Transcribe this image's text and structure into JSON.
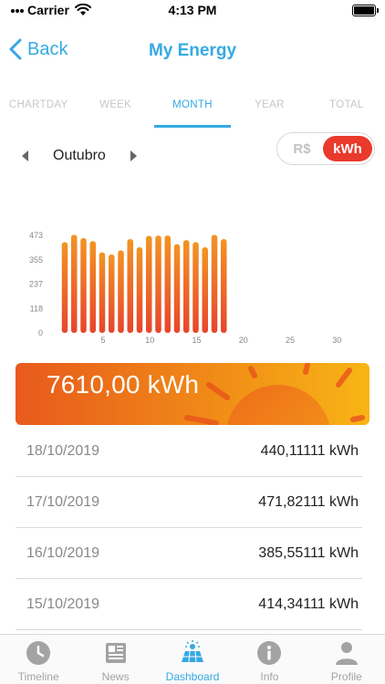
{
  "status_bar": {
    "carrier": "Carrier",
    "time": "4:13 PM"
  },
  "nav": {
    "back_label": "Back",
    "title": "My Energy"
  },
  "tabs": [
    {
      "label": "CHARTDAY",
      "active": false
    },
    {
      "label": "WEEK",
      "active": false
    },
    {
      "label": "MONTH",
      "active": true
    },
    {
      "label": "YEAR",
      "active": false
    },
    {
      "label": "TOTAL",
      "active": false
    }
  ],
  "month_selector": {
    "label": "Outubro"
  },
  "unit_toggle": {
    "currency_label": "R$",
    "kwh_label": "kWh",
    "selected": "kWh"
  },
  "chart_data": {
    "type": "bar",
    "x": [
      1,
      2,
      3,
      4,
      5,
      6,
      7,
      8,
      9,
      10,
      11,
      12,
      13,
      14,
      15,
      16,
      17,
      18
    ],
    "values": [
      440,
      475,
      460,
      445,
      390,
      380,
      400,
      455,
      415,
      470,
      472,
      472,
      430,
      450,
      440,
      415,
      475,
      455
    ],
    "y_ticks": [
      "473",
      "355",
      "237",
      "118",
      "0"
    ],
    "x_ticks": [
      "5",
      "10",
      "15",
      "20",
      "25",
      "30"
    ],
    "ylim": [
      0,
      473
    ],
    "xlim": [
      1,
      31
    ],
    "colors": {
      "bar_top": "#f39424",
      "bar_bottom": "#e8452c"
    }
  },
  "banner": {
    "total": "7610,00 kWh"
  },
  "list": [
    {
      "date": "18/10/2019",
      "value": "440,11111 kWh"
    },
    {
      "date": "17/10/2019",
      "value": "471,82111 kWh"
    },
    {
      "date": "16/10/2019",
      "value": "385,55111 kWh"
    },
    {
      "date": "15/10/2019",
      "value": "414,34111 kWh"
    }
  ],
  "tabbar": [
    {
      "label": "Timeline",
      "icon": "clock-icon",
      "active": false
    },
    {
      "label": "News",
      "icon": "newspaper-icon",
      "active": false
    },
    {
      "label": "Dashboard",
      "icon": "solar-panel-icon",
      "active": true
    },
    {
      "label": "Info",
      "icon": "info-icon",
      "active": false
    },
    {
      "label": "Profile",
      "icon": "person-icon",
      "active": false
    }
  ],
  "colors": {
    "accent": "#35a9e2",
    "highlight": "#ea3a2c"
  }
}
